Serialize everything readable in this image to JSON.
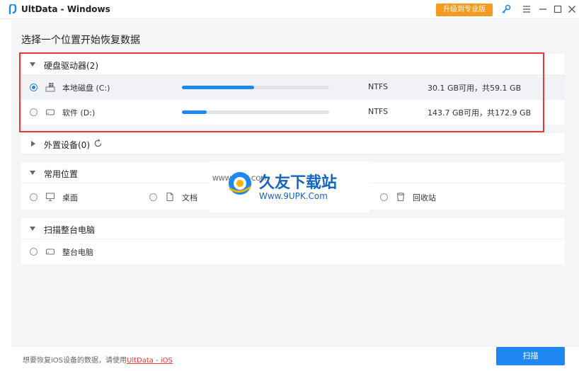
{
  "window": {
    "title": "UltData - Windows",
    "upgrade_label": "升级到专业版"
  },
  "page": {
    "title": "选择一个位置开始恢复数据"
  },
  "sections": {
    "drives": {
      "title": "硬盘驱动器(2)",
      "items": [
        {
          "name": "本地磁盘 (C:)",
          "fs": "NTFS",
          "size": "30.1 GB可用，共59.1 GB",
          "usage": 0.49,
          "selected": true
        },
        {
          "name": "软件 (D:)",
          "fs": "NTFS",
          "size": "143.7 GB可用，共172.9 GB",
          "usage": 0.17,
          "selected": false
        }
      ]
    },
    "external": {
      "title": "外置设备(0)"
    },
    "common": {
      "title": "常用位置",
      "items": [
        {
          "name": "桌面"
        },
        {
          "name": "文档"
        },
        {
          "name": "回收站"
        }
      ]
    },
    "full_scan": {
      "title": "扫描整台电脑",
      "items": [
        {
          "name": "整台电脑"
        }
      ]
    }
  },
  "watermark": {
    "brand": "久友下载站",
    "url": "Www.9UPK.Com",
    "www_text": "WWW.9UPK.COM"
  },
  "footer": {
    "hint": "想要恢复iOS设备的数据，请使用",
    "link": "UltData - iOS",
    "scan_label": "扫描"
  },
  "colors": {
    "accent": "#1e88f0",
    "upgrade": "#f59a1f",
    "highlight_frame": "#e53935"
  }
}
